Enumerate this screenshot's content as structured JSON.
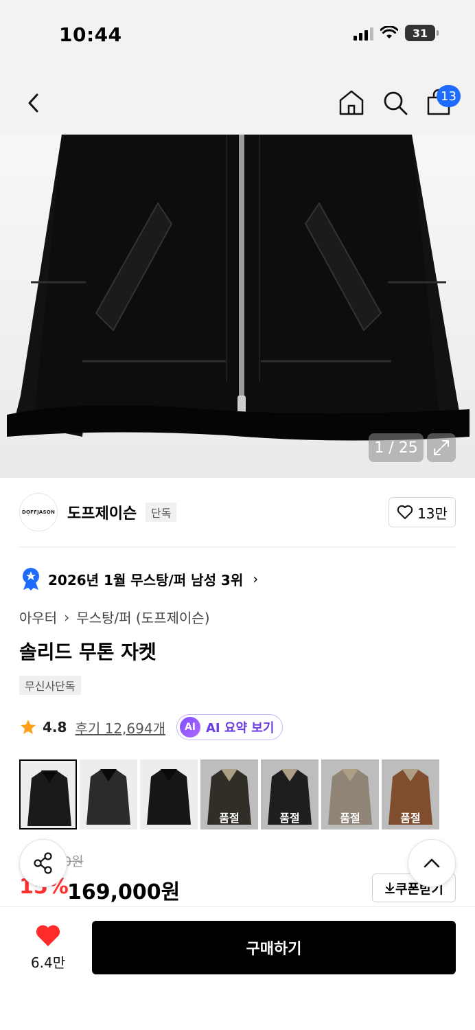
{
  "status_bar": {
    "time": "10:44",
    "battery": "31"
  },
  "nav": {
    "cart_count": "13"
  },
  "gallery": {
    "counter": "1 / 25"
  },
  "brand": {
    "logo_text": "DOFFJASON",
    "name": "도프제이슨",
    "tag": "단독",
    "likes": "13만"
  },
  "ranking": {
    "text": "2026년 1월 무스탕/퍼 남성 3위"
  },
  "breadcrumb": {
    "category": "아우터",
    "sub": "무스탕/퍼 (도프제이슨)"
  },
  "product": {
    "title": "솔리드 무톤 자켓",
    "badge": "무신사단독"
  },
  "rating": {
    "score": "4.8",
    "reviews": "후기 12,694개",
    "ai_badge": "AI",
    "ai_label": "AI 요약 보기"
  },
  "swatches": [
    {
      "name": "black-fur",
      "color": "#1a1a1a",
      "sold": ""
    },
    {
      "name": "black-model",
      "color": "#2b2b2b",
      "sold": ""
    },
    {
      "name": "black-plain",
      "color": "#161616",
      "sold": ""
    },
    {
      "name": "brown-model",
      "color": "#3e3a33",
      "sold": "품절"
    },
    {
      "name": "black-tan",
      "color": "#26262a",
      "sold": "품절"
    },
    {
      "name": "beige",
      "color": "#b3a694",
      "sold": "품절"
    },
    {
      "name": "camel",
      "color": "#a0623a",
      "sold": "품절"
    }
  ],
  "pricing": {
    "original": "0원",
    "discount": "15%",
    "price": "169,000원",
    "coupon": "쿠폰받기"
  },
  "bottom": {
    "wish_count": "6.4만",
    "buy_label": "구매하기"
  }
}
